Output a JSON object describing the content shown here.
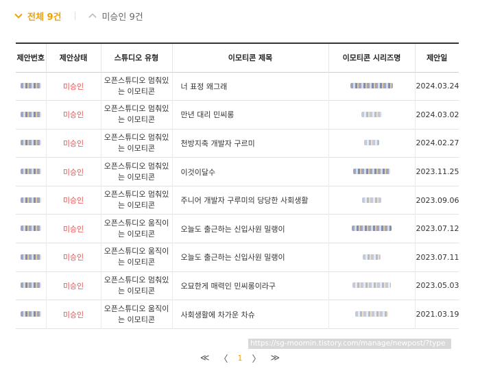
{
  "filters": {
    "all_label": "전체 9건",
    "pending_label": "미승인 9건"
  },
  "table": {
    "headers": [
      "제안번호",
      "제안상태",
      "스튜디오 유형",
      "이모티콘 제목",
      "이모티콘 시리즈명",
      "제안일"
    ],
    "rows": [
      {
        "status": "미승인",
        "type": "오픈스튜디오 멈춰있는 이모티콘",
        "title": "너 표정 왜그래",
        "date": "2024.03.24"
      },
      {
        "status": "미승인",
        "type": "오픈스튜디오 멈춰있는 이모티콘",
        "title": "만년 대리 민씨롱",
        "date": "2024.03.02"
      },
      {
        "status": "미승인",
        "type": "오픈스튜디오 멈춰있는 이모티콘",
        "title": "천방지축 개발자 구르미",
        "date": "2024.02.27"
      },
      {
        "status": "미승인",
        "type": "오픈스튜디오 멈춰있는 이모티콘",
        "title": "이것이달수",
        "date": "2023.11.25"
      },
      {
        "status": "미승인",
        "type": "오픈스튜디오 멈춰있는 이모티콘",
        "title": "주니어 개발자 구루미의 당당한 사회생활",
        "date": "2023.09.06"
      },
      {
        "status": "미승인",
        "type": "오픈스튜디오 움직이는 이모티콘",
        "title": "오늘도 출근하는 신입사원 밀랭이",
        "date": "2023.07.12"
      },
      {
        "status": "미승인",
        "type": "오픈스튜디오 움직이는 이모티콘",
        "title": "오늘도 출근하는 신입사원 밀랭이",
        "date": "2023.07.11"
      },
      {
        "status": "미승인",
        "type": "오픈스튜디오 멈춰있는 이모티콘",
        "title": "오묘한게 매력인 민씨롱이라구",
        "date": "2023.05.03"
      },
      {
        "status": "미승인",
        "type": "오픈스튜디오 움직이는 이모티콘",
        "title": "사회생활에 차가운 차슈",
        "date": "2021.03.19"
      }
    ]
  },
  "pagination": {
    "first": "≪",
    "prev": "〈",
    "current": "1",
    "next": "〉",
    "last": "≫"
  },
  "url_overlay": "https://sg-moomin.tistory.com/manage/newpost/?type"
}
